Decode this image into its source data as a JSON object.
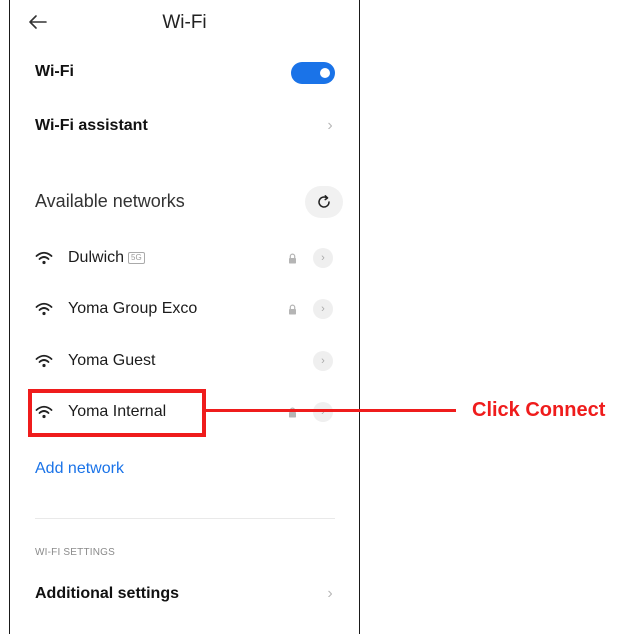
{
  "header": {
    "title": "Wi-Fi",
    "back_icon": "back-arrow-icon"
  },
  "wifi_toggle": {
    "label": "Wi-Fi",
    "state": "on",
    "accent": "#1a73e8"
  },
  "assistant": {
    "label": "Wi-Fi assistant"
  },
  "available": {
    "title": "Available networks",
    "refresh_icon": "refresh-icon"
  },
  "networks": [
    {
      "name": "Dulwich",
      "badge": "5G",
      "locked": true
    },
    {
      "name": "Yoma Group Exco",
      "badge": "",
      "locked": true
    },
    {
      "name": "Yoma Guest",
      "badge": "",
      "locked": false
    },
    {
      "name": "Yoma Internal",
      "badge": "",
      "locked": true
    }
  ],
  "add_network": {
    "label": "Add network"
  },
  "settings": {
    "caption": "WI-FI SETTINGS",
    "additional_label": "Additional settings"
  },
  "annotation": {
    "callout_text": "Click Connect",
    "color": "#ef1c1c"
  }
}
